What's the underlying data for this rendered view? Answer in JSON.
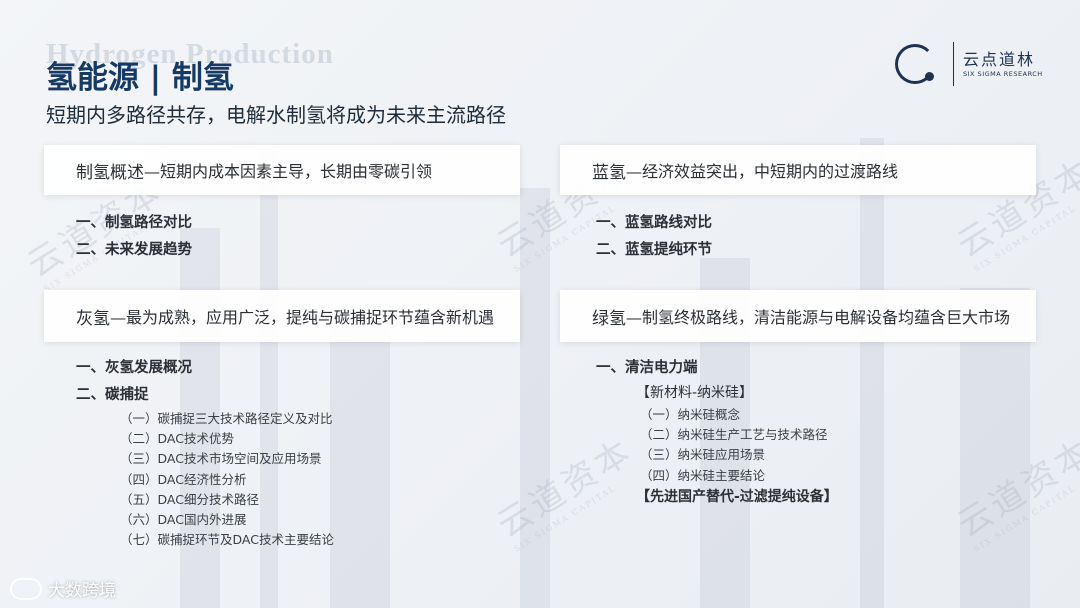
{
  "header": {
    "title_en": "Hydrogen  Production",
    "title_cn": "氢能源 | 制氢",
    "subtitle": "短期内多路径共存，电解水制氢将成为未来主流路径"
  },
  "logo": {
    "name": "云点道林",
    "tagline": "SIX SIGMA RESEARCH"
  },
  "watermark": {
    "text": "云道资本",
    "sub": "SIX SIGMA CAPITAL"
  },
  "cards": {
    "overview": {
      "heading": "制氢概述",
      "text": "—短期内成本因素主导，长期由零碳引领"
    },
    "blue": {
      "heading": "蓝氢",
      "text": "—经济效益突出，中短期内的过渡路线"
    },
    "grey": {
      "heading": "灰氢",
      "text": "—最为成熟，应用广泛，提纯与碳捕捉环节蕴含新机遇"
    },
    "green": {
      "heading": "绿氢",
      "text": "—制氢终极路线，清洁能源与电解设备均蕴含巨大市场"
    }
  },
  "lists": {
    "overview": [
      "一、制氢路径对比",
      "二、未来发展趋势"
    ],
    "blue": [
      "一、蓝氢路线对比",
      "二、蓝氢提纯环节"
    ],
    "grey": {
      "l1a": "一、灰氢发展概况",
      "l1b": "二、碳捕捉",
      "sub": [
        "（一）碳捕捉三大技术路径定义及对比",
        "（二）DAC技术优势",
        "（三）DAC技术市场空间及应用场景",
        "（四）DAC经济性分析",
        "（五）DAC细分技术路径",
        "（六）DAC国内外进展",
        "（七）碳捕捉环节及DAC技术主要结论"
      ]
    },
    "green": {
      "l1": "一、清洁电力端",
      "group1": "【新材料-纳米硅】",
      "sub": [
        "（一）纳米硅概念",
        "（二）纳米硅生产工艺与技术路径",
        "（三）纳米硅应用场景",
        "（四）纳米硅主要结论"
      ],
      "group2": "【先进国产替代-过滤提纯设备】"
    }
  },
  "footer": {
    "brand": "大数跨境"
  }
}
